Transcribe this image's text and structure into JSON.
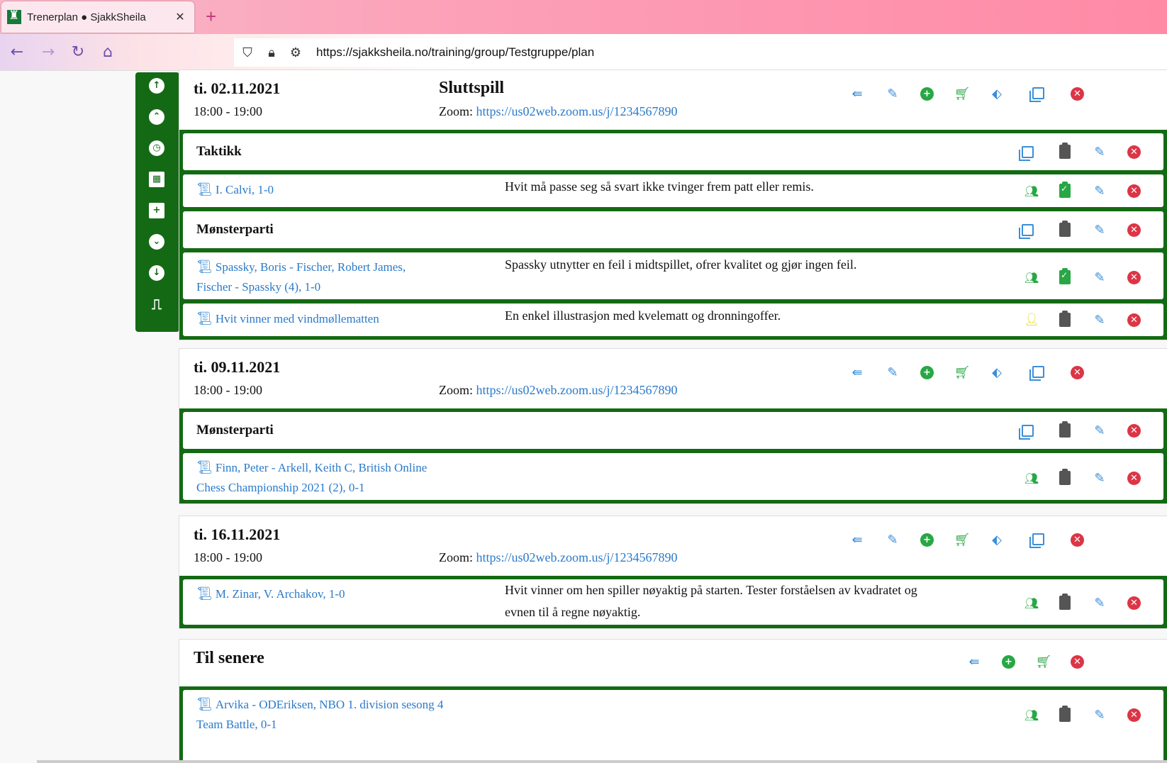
{
  "browser": {
    "tab_title": "Trenerplan ● SjakkSheila",
    "tab_close": "✕",
    "new_tab": "+",
    "url": "https://sjakksheila.no/training/group/Testgruppe/plan"
  },
  "sidenav": {
    "items": [
      "move-top",
      "move-up",
      "time",
      "calendar",
      "calendar-add",
      "move-down",
      "move-bottom",
      "exit"
    ]
  },
  "lessons": [
    {
      "date": "ti. 02.11.2021",
      "time": "18:00 - 19:00",
      "title": "Sluttspill",
      "zoom_label": "Zoom:",
      "zoom_url": "https://us02web.zoom.us/j/1234567890",
      "sections": [
        {
          "kind": "header",
          "label": "Taktikk"
        },
        {
          "kind": "item",
          "link": "I. Calvi, 1-0",
          "desc": "Hvit må passe seg så svart ikke tvinger frem patt eller remis.",
          "done": true,
          "group": "users"
        },
        {
          "kind": "header",
          "label": "Mønsterparti"
        },
        {
          "kind": "item",
          "link": "Spassky, Boris - Fischer, Robert James, Fischer - Spassky (4), 1-0",
          "desc": "Spassky utnytter en feil i midtspillet, ofrer kvalitet og gjør ingen feil.",
          "done": true,
          "group": "users"
        },
        {
          "kind": "item",
          "link": "Hvit vinner med vindmøllematten",
          "desc": "En enkel illustrasjon med kvelematt og dronningoffer.",
          "done": false,
          "group": "user"
        }
      ]
    },
    {
      "date": "ti. 09.11.2021",
      "time": "18:00 - 19:00",
      "title": "",
      "zoom_label": "Zoom:",
      "zoom_url": "https://us02web.zoom.us/j/1234567890",
      "sections": [
        {
          "kind": "header",
          "label": "Mønsterparti"
        },
        {
          "kind": "item",
          "link": "Finn, Peter - Arkell, Keith C, British Online Chess Championship 2021 (2), 0-1",
          "desc": "",
          "done": false,
          "group": "users"
        }
      ]
    },
    {
      "date": "ti. 16.11.2021",
      "time": "18:00 - 19:00",
      "title": "",
      "zoom_label": "Zoom:",
      "zoom_url": "https://us02web.zoom.us/j/1234567890",
      "sections": [
        {
          "kind": "item",
          "link": "M. Zinar, V. Archakov, 1-0",
          "desc": "Hvit vinner om hen spiller nøyaktig på starten. Tester forståelsen av kvadratet og evnen til å regne nøyaktig.",
          "done": false,
          "group": "users"
        }
      ]
    }
  ],
  "later": {
    "title": "Til senere",
    "sections": [
      {
        "kind": "item",
        "link": "Arvika - ODEriksen, NBO 1. division sesong 4 Team Battle, 0-1",
        "desc": "",
        "done": false,
        "group": "users"
      }
    ]
  },
  "colors": {
    "green_dark": "#146a14",
    "link_blue": "#2a7ac9",
    "icon_blue": "#3b8ed8",
    "icon_green": "#28a745",
    "icon_red": "#dc3545",
    "icon_yellow": "#e6d600"
  }
}
